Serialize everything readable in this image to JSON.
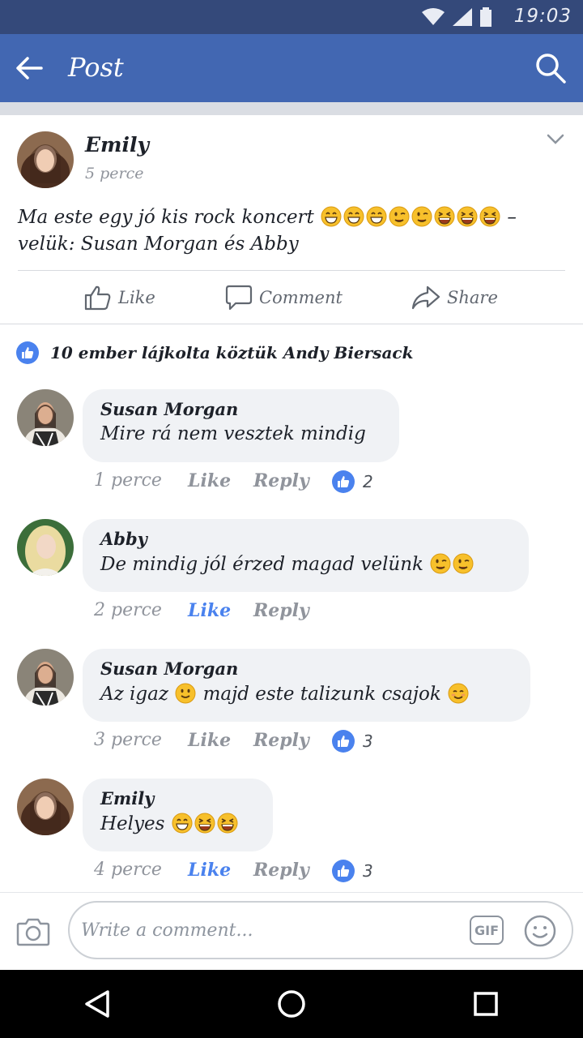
{
  "status_bar": {
    "time": "19:03",
    "icons": [
      "wifi-icon",
      "cell-signal-icon",
      "battery-icon"
    ]
  },
  "header": {
    "title": "Post",
    "back_icon": "arrow-left-icon",
    "search_icon": "search-icon",
    "background_color": "#4267b2"
  },
  "post": {
    "author": "Emily",
    "time": "5 perce",
    "text": "Ma este egy jó kis rock koncert",
    "text_emoji_count": 8,
    "text_suffix": " – velük: Susan Morgan és Abby",
    "actions": {
      "like": "Like",
      "comment": "Comment",
      "share": "Share"
    }
  },
  "likes_summary": {
    "text": "10 ember lájkolta köztük Andy Biersack"
  },
  "comments": [
    {
      "author": "Susan Morgan",
      "text": "Mire rá nem vesztek mindig",
      "time": "1 perce",
      "like": "Like",
      "like_active": false,
      "reply": "Reply",
      "reaction_count": "2"
    },
    {
      "author": "Abby",
      "text": "De mindig jól érzed magad velünk",
      "time": "2 perce",
      "like": "Like",
      "like_active": true,
      "reply": "Reply",
      "reaction_count": ""
    },
    {
      "author": "Susan Morgan",
      "text_part1": "Az igaz",
      "text_part2": "majd este talizunk csajok",
      "time": "3 perce",
      "like": "Like",
      "like_active": false,
      "reply": "Reply",
      "reaction_count": "3"
    },
    {
      "author": "Emily",
      "text": "Helyes",
      "time": "4 perce",
      "like": "Like",
      "like_active": true,
      "reply": "Reply",
      "reaction_count": "3"
    }
  ],
  "composer": {
    "placeholder": "Write a comment...",
    "gif_label": "GIF"
  },
  "colors": {
    "accent": "#4a82ee",
    "header": "#4267b2",
    "status_bar": "#34497a"
  }
}
